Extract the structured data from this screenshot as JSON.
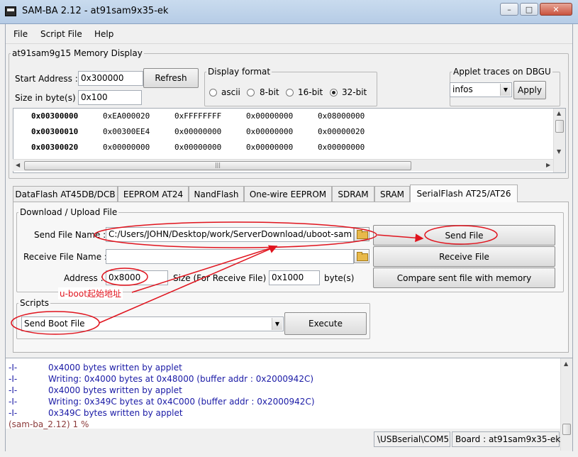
{
  "window": {
    "title": "SAM-BA 2.12  -  at91sam9x35-ek"
  },
  "menu": [
    "File",
    "Script File",
    "Help"
  ],
  "memory_display": {
    "title": "at91sam9g15 Memory Display",
    "start_address_label": "Start Address :",
    "start_address_value": "0x300000",
    "refresh_label": "Refresh",
    "size_label": "Size in byte(s) :",
    "size_value": "0x100",
    "display_format": {
      "title": "Display format",
      "options": [
        "ascii",
        "8-bit",
        "16-bit",
        "32-bit"
      ],
      "selected": "32-bit"
    },
    "applet_traces": {
      "title": "Applet traces on DBGU",
      "value": "infos",
      "apply_label": "Apply"
    },
    "rows": [
      {
        "addr": "0x00300000",
        "cells": [
          "0xEA000020",
          "0xFFFFFFFF",
          "0x00000000",
          "0x08000000"
        ]
      },
      {
        "addr": "0x00300010",
        "cells": [
          "0x00300EE4",
          "0x00000000",
          "0x00000000",
          "0x00000020"
        ]
      },
      {
        "addr": "0x00300020",
        "cells": [
          "0x00000000",
          "0x00000000",
          "0x00000000",
          "0x00000000"
        ]
      }
    ]
  },
  "tabs": [
    "DataFlash AT45DB/DCB",
    "EEPROM AT24",
    "NandFlash",
    "One-wire EEPROM",
    "SDRAM",
    "SRAM",
    "SerialFlash AT25/AT26"
  ],
  "active_tab": "SerialFlash AT25/AT26",
  "download_upload": {
    "title": "Download / Upload File",
    "send_label": "Send File Name :",
    "send_value": "C:/Users/JOHN/Desktop/work/ServerDownload/uboot-sam",
    "receive_label": "Receive File Name :",
    "receive_value": "",
    "address_label": "Address :",
    "address_value": "0x8000",
    "size_label": "Size (For Receive File) :",
    "size_value": "0x1000",
    "size_unit": "byte(s)",
    "send_button": "Send File",
    "receive_button": "Receive File",
    "compare_button": "Compare sent file with memory"
  },
  "scripts": {
    "title": "Scripts",
    "value": "Send Boot File",
    "execute_label": "Execute"
  },
  "annotation": {
    "note": "u-boot起始地址",
    "color": "#e0141e"
  },
  "log": {
    "lines": [
      {
        "tag": "-I-",
        "msg": "0x4000 bytes written by applet"
      },
      {
        "tag": "-I-",
        "msg": "Writing: 0x4000 bytes at 0x48000 (buffer addr : 0x2000942C)"
      },
      {
        "tag": "-I-",
        "msg": "0x4000 bytes written by applet"
      },
      {
        "tag": "-I-",
        "msg": "Writing: 0x349C bytes at 0x4C000 (buffer addr : 0x2000942C)"
      },
      {
        "tag": "-I-",
        "msg": "0x349C bytes written by applet"
      }
    ],
    "prompt": "(sam-ba_2.12) 1 %"
  },
  "status": {
    "connection": "\\USBserial\\COM5",
    "board": "Board : at91sam9x35-ek"
  }
}
